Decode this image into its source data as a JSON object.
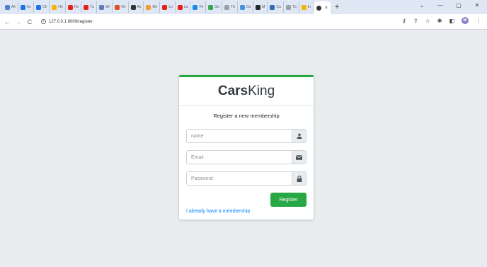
{
  "browser": {
    "tabs": [
      {
        "label": "Ali",
        "color": "#4f7fd6"
      },
      {
        "label": "Co",
        "color": "#1a73e8"
      },
      {
        "label": "Ch",
        "color": "#1a73e8"
      },
      {
        "label": "He",
        "color": "#f4b400"
      },
      {
        "label": "He",
        "color": "#e62117"
      },
      {
        "label": "Tu",
        "color": "#e62117"
      },
      {
        "label": "Wr",
        "color": "#5f7fb8"
      },
      {
        "label": "Ov",
        "color": "#e44d26"
      },
      {
        "label": "As",
        "color": "#333333"
      },
      {
        "label": "Mo",
        "color": "#f0a030"
      },
      {
        "label": "Lo",
        "color": "#e62117"
      },
      {
        "label": "La",
        "color": "#e62117"
      },
      {
        "label": "Fir",
        "color": "#1e88e5"
      },
      {
        "label": "Go",
        "color": "#34a853"
      },
      {
        "label": "Tü",
        "color": "#9aa0a6"
      },
      {
        "label": "Ca",
        "color": "#4a90e2"
      },
      {
        "label": "M",
        "color": "#24292e"
      },
      {
        "label": "Ca",
        "color": "#2e6db4"
      },
      {
        "label": "Tü",
        "color": "#9aa0a6"
      },
      {
        "label": "In",
        "color": "#f4b400"
      }
    ],
    "active_tab_color": "#333333",
    "close_glyph": "×",
    "new_tab_glyph": "+",
    "window_controls": {
      "dropdown": "⌄",
      "minimize": "—",
      "maximize": "▢",
      "close": "✕"
    },
    "url": "127.0.0.1:8000/register",
    "profile_initial": "M"
  },
  "card": {
    "brand_bold": "Cars",
    "brand_light": "King",
    "message": "Register a new membership",
    "fields": {
      "name_placeholder": "name",
      "email_placeholder": "Email",
      "password_placeholder": "Password"
    },
    "register_label": "Register",
    "membership_link": "I already have a membership"
  },
  "colors": {
    "accent": "#28a745",
    "link": "#007bff",
    "page_bg": "#e9ecef"
  }
}
